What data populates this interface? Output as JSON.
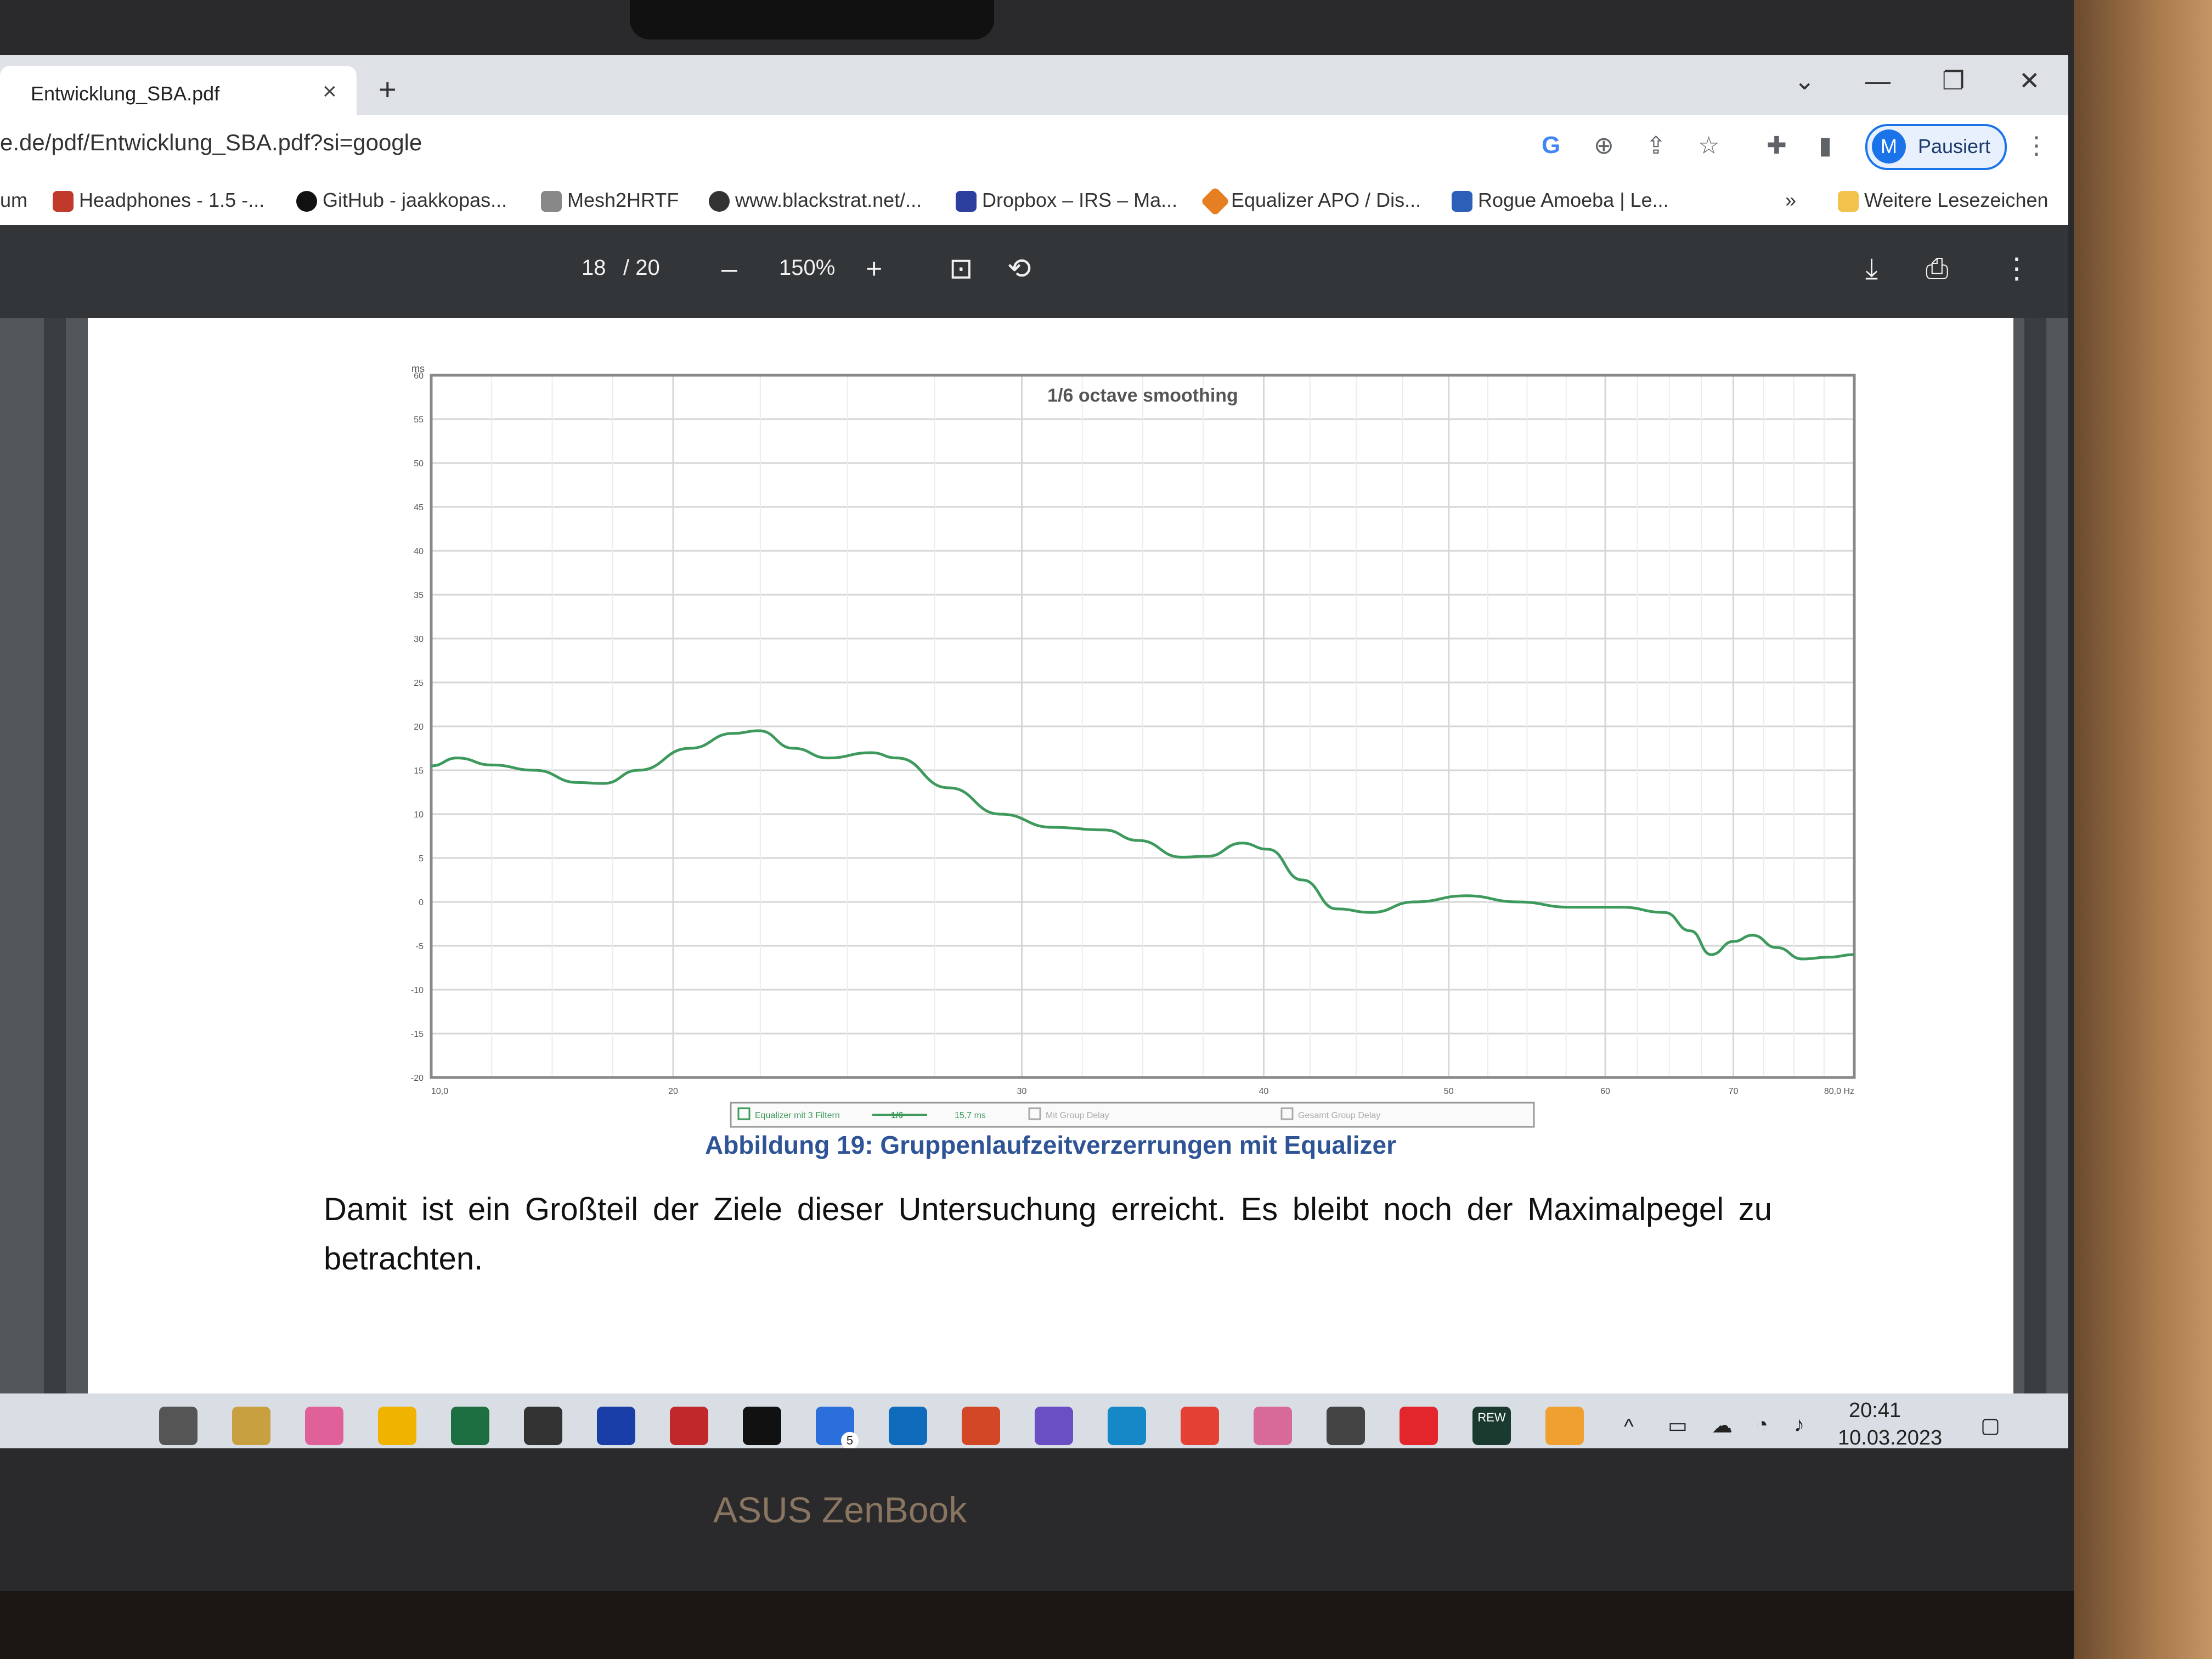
{
  "browser": {
    "tab_title": "Entwicklung_SBA.pdf",
    "url": "e.de/pdf/Entwicklung_SBA.pdf?si=google",
    "profile_initial": "M",
    "profile_status": "Pausiert",
    "bookmarks": [
      {
        "label": "um",
        "color": "#ffffff"
      },
      {
        "label": "Headphones - 1.5 -...",
        "color": "#c0392b"
      },
      {
        "label": "GitHub - jaakkopas...",
        "color": "#111111"
      },
      {
        "label": "Mesh2HRTF",
        "color": "#444444"
      },
      {
        "label": "www.blackstrat.net/...",
        "color": "#333333"
      },
      {
        "label": "Dropbox – IRS – Ma...",
        "color": "#2c3e9e"
      },
      {
        "label": "Equalizer APO / Dis...",
        "color": "#e67e22"
      },
      {
        "label": "Rogue Amoeba | Le...",
        "color": "#2c5fb8"
      }
    ],
    "more_bookmarks": "Weitere Lesezeichen"
  },
  "pdf_toolbar": {
    "page": "18",
    "page_total": "/ 20",
    "zoom": "150%"
  },
  "chart_data": {
    "type": "line",
    "title": "1/6 octave smoothing",
    "xlabel": "",
    "ylabel": "ms",
    "x_ticks": [
      "10,0",
      "20",
      "30",
      "40",
      "50",
      "60",
      "70",
      "80,0 Hz"
    ],
    "y_ticks": [
      "60",
      "55",
      "50",
      "45",
      "40",
      "35",
      "30",
      "25",
      "20",
      "15",
      "10",
      "5",
      "0",
      "-5",
      "-10",
      "-15",
      "-20"
    ],
    "xlim": [
      10,
      80
    ],
    "ylim": [
      -20,
      60
    ],
    "grid": true,
    "legend_position": "bottom",
    "legend_entries": [
      "Equalizer mit 3 Filtern",
      "1/6",
      "15,7 ms",
      "Mit Group Delay",
      "Gesamt Group Delay"
    ],
    "series": [
      {
        "name": "Equalizer mit 3 Filtern",
        "color": "#3d9a5c",
        "points": [
          [
            10.0,
            15.5
          ],
          [
            11.5,
            16.4
          ],
          [
            13.5,
            15.6
          ],
          [
            16.0,
            15.0
          ],
          [
            18.5,
            13.6
          ],
          [
            20.0,
            13.5
          ],
          [
            22.0,
            15.0
          ],
          [
            25.0,
            17.5
          ],
          [
            27.5,
            19.2
          ],
          [
            29.0,
            19.5
          ],
          [
            31.0,
            17.5
          ],
          [
            33.0,
            16.4
          ],
          [
            35.5,
            17.0
          ],
          [
            37.0,
            16.4
          ],
          [
            40.0,
            13.0
          ],
          [
            43.0,
            10.0
          ],
          [
            46.0,
            8.5
          ],
          [
            49.0,
            8.2
          ],
          [
            51.0,
            7.0
          ],
          [
            53.5,
            5.1
          ],
          [
            55.0,
            5.2
          ],
          [
            57.0,
            6.7
          ],
          [
            58.5,
            6.0
          ],
          [
            60.5,
            2.5
          ],
          [
            62.5,
            -0.8
          ],
          [
            64.5,
            -1.2
          ],
          [
            67.0,
            0.0
          ],
          [
            70.0,
            0.7
          ],
          [
            73.0,
            0.0
          ],
          [
            76.0,
            -0.6
          ],
          [
            79.0,
            -0.6
          ],
          [
            81.5,
            -1.2
          ],
          [
            83.0,
            -3.3
          ],
          [
            84.2,
            -6.0
          ],
          [
            85.5,
            -4.5
          ],
          [
            86.6,
            -3.8
          ],
          [
            88.0,
            -5.2
          ],
          [
            89.5,
            -6.5
          ],
          [
            91.0,
            -6.3
          ],
          [
            92.5,
            -6.0
          ]
        ]
      }
    ]
  },
  "document": {
    "caption": "Abbildung 19: Gruppenlaufzeitverzerrungen mit Equalizer",
    "paragraph": "Damit ist ein Großteil der Ziele dieser Untersuchung erreicht. Es bleibt noch der Maximalpegel zu betrachten."
  },
  "taskbar": {
    "time": "20:41",
    "date": "10.03.2023",
    "mail_badge": "5",
    "apps": [
      {
        "name": "task-view",
        "color": "#555555"
      },
      {
        "name": "notes",
        "color": "#c8a040"
      },
      {
        "name": "itunes",
        "color": "#e0609a"
      },
      {
        "name": "file-explorer",
        "color": "#f0b400"
      },
      {
        "name": "excel",
        "color": "#1d6f42"
      },
      {
        "name": "ue-app",
        "color": "#333333"
      },
      {
        "name": "app-blue",
        "color": "#1a3ea8"
      },
      {
        "name": "mcafee",
        "color": "#c0282b"
      },
      {
        "name": "camera-app",
        "color": "#111111"
      },
      {
        "name": "mail",
        "color": "#2a6fdb"
      },
      {
        "name": "outlook",
        "color": "#0f6cbd"
      },
      {
        "name": "powerpoint",
        "color": "#d24726"
      },
      {
        "name": "app-purple",
        "color": "#6a4fc4"
      },
      {
        "name": "edge",
        "color": "#1588c8"
      },
      {
        "name": "chrome",
        "color": "#e44134"
      },
      {
        "name": "snip",
        "color": "#d86a9a"
      },
      {
        "name": "media-player",
        "color": "#444444"
      },
      {
        "name": "acrobat",
        "color": "#e3262c"
      },
      {
        "name": "rew",
        "color": "#1a3a30"
      },
      {
        "name": "app-orange",
        "color": "#f0a030"
      }
    ],
    "rew_label": "REW"
  },
  "laptop_brand": "ASUS ZenBook"
}
